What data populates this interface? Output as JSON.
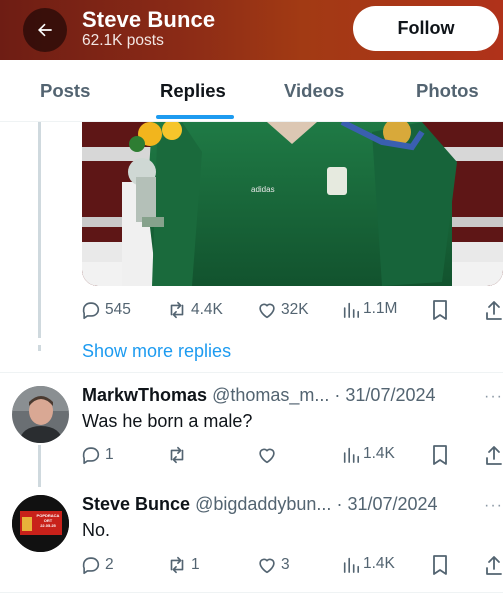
{
  "header": {
    "title": "Steve Bunce",
    "subtitle": "62.1K posts",
    "follow_label": "Follow",
    "gradient": [
      "#6e1d14",
      "#b0321a"
    ]
  },
  "tabs": [
    {
      "label": "Posts",
      "active": false
    },
    {
      "label": "Replies",
      "active": true
    },
    {
      "label": "Videos",
      "active": false
    },
    {
      "label": "Photos",
      "active": false
    }
  ],
  "accent_color": "#1d9bf0",
  "main_post": {
    "media_icon": "boxer-with-medal-photo",
    "actions": {
      "replies": "545",
      "reposts": "4.4K",
      "likes": "32K",
      "views": "1.1M"
    }
  },
  "show_more_label": "Show more replies",
  "replies": [
    {
      "name": "MarkwThomas",
      "handle": "@thomas_m...",
      "date": "31/07/2024",
      "text": "Was he born a male?",
      "actions": {
        "replies": "1",
        "reposts": "",
        "likes": "",
        "views": "1.4K"
      }
    },
    {
      "name": "Steve Bunce",
      "handle": "@bigdaddybun...",
      "date": "31/07/2024",
      "text": "No.",
      "avatar_text": [
        "POPDRACA",
        "ORT",
        "22.05.25"
      ],
      "actions": {
        "replies": "2",
        "reposts": "1",
        "likes": "3",
        "views": "1.4K"
      }
    }
  ]
}
